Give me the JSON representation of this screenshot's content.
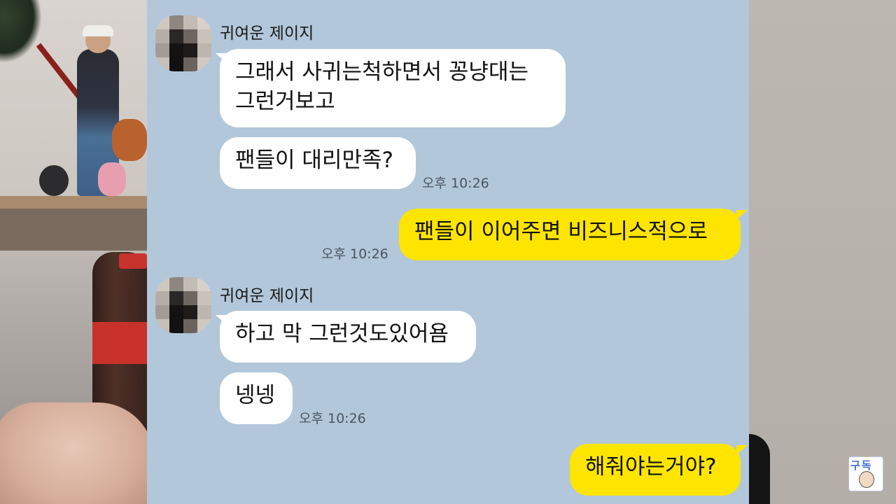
{
  "chat": {
    "messages": [
      {
        "sender": "귀여운 제이지",
        "text": "그래서 사귀는척하면서 꽁냥대는\n그런거보고",
        "side": "in"
      },
      {
        "sender": "귀여운 제이지",
        "text": "팬들이 대리만족?",
        "side": "in",
        "time": "오후 10:26"
      },
      {
        "sender": "me",
        "text": "팬들이 이어주면 비즈니스적으로",
        "side": "out",
        "time": "오후 10:26"
      },
      {
        "sender": "귀여운 제이지",
        "text": "하고 막 그런것도있어욤",
        "side": "in"
      },
      {
        "sender": "귀여운 제이지",
        "text": "넹넹",
        "side": "in",
        "time": "오후 10:26"
      },
      {
        "sender": "me",
        "text": "해줘야는거야?",
        "side": "out"
      }
    ],
    "sender_name": "귀여운 제이지"
  },
  "colors": {
    "chat_background": "#b2c7da",
    "incoming_bubble": "#ffffff",
    "outgoing_bubble": "#fee500"
  },
  "badge": {
    "text": "구독",
    "icon": "subscribe-avatar-icon"
  }
}
